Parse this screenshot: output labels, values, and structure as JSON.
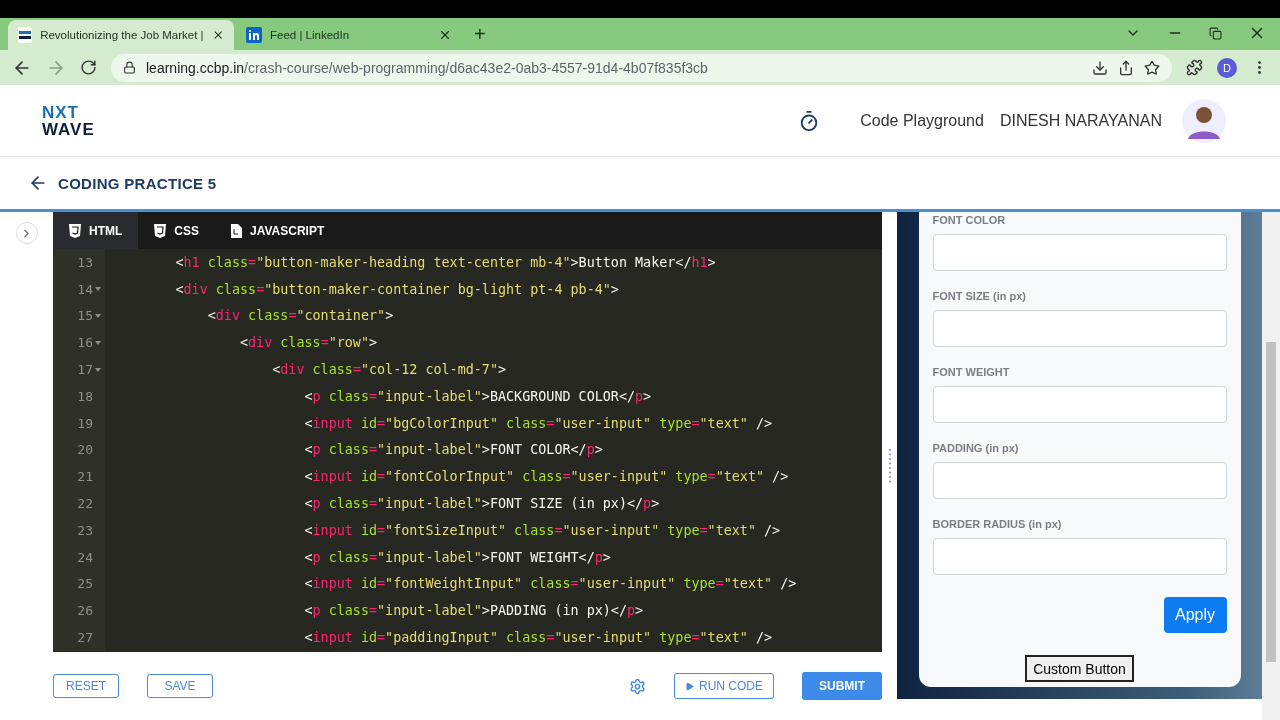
{
  "browser": {
    "tabs": [
      {
        "title": "Revolutionizing the Job Market |",
        "selected": true
      },
      {
        "title": "Feed | LinkedIn",
        "selected": false
      }
    ],
    "new_tab": "+",
    "url_host": "learning.ccbp.in",
    "url_path": "/crash-course/web-programming/d6ac43e2-0ab3-4557-91d4-4b07f835f3cb",
    "profile": "D"
  },
  "header": {
    "logo_top": "NXT",
    "logo_bottom": "WAVE",
    "playground": "Code Playground",
    "user": "DINESH NARAYANAN"
  },
  "page_title": "CODING PRACTICE 5",
  "editor": {
    "tabs": [
      {
        "label": "HTML",
        "selected": true
      },
      {
        "label": "CSS",
        "selected": false
      },
      {
        "label": "JAVASCRIPT",
        "selected": false
      }
    ],
    "lines": [
      {
        "number": "13",
        "text": "        <h1 class=\"button-maker-heading text-center mb-4\">Button Maker</h1>",
        "foldable": false
      },
      {
        "number": "14",
        "text": "        <div class=\"button-maker-container bg-light pt-4 pb-4\">",
        "foldable": true
      },
      {
        "number": "15",
        "text": "            <div class=\"container\">",
        "foldable": true
      },
      {
        "number": "16",
        "text": "                <div class=\"row\">",
        "foldable": true
      },
      {
        "number": "17",
        "text": "                    <div class=\"col-12 col-md-7\">",
        "foldable": true
      },
      {
        "number": "18",
        "text": "                        <p class=\"input-label\">BACKGROUND COLOR</p>",
        "foldable": false
      },
      {
        "number": "19",
        "text": "                        <input id=\"bgColorInput\" class=\"user-input\" type=\"text\" />",
        "foldable": false
      },
      {
        "number": "20",
        "text": "                        <p class=\"input-label\">FONT COLOR</p>",
        "foldable": false
      },
      {
        "number": "21",
        "text": "                        <input id=\"fontColorInput\" class=\"user-input\" type=\"text\" />",
        "foldable": false
      },
      {
        "number": "22",
        "text": "                        <p class=\"input-label\">FONT SIZE (in px)</p>",
        "foldable": false
      },
      {
        "number": "23",
        "text": "                        <input id=\"fontSizeInput\" class=\"user-input\" type=\"text\" />",
        "foldable": false
      },
      {
        "number": "24",
        "text": "                        <p class=\"input-label\">FONT WEIGHT</p>",
        "foldable": false
      },
      {
        "number": "25",
        "text": "                        <input id=\"fontWeightInput\" class=\"user-input\" type=\"text\" />",
        "foldable": false
      },
      {
        "number": "26",
        "text": "                        <p class=\"input-label\">PADDING (in px)</p>",
        "foldable": false
      },
      {
        "number": "27",
        "text": "                        <input id=\"paddingInput\" class=\"user-input\" type=\"text\" />",
        "foldable": false
      }
    ]
  },
  "actions": {
    "reset": "RESET",
    "save": "SAVE",
    "run": "RUN CODE",
    "submit": "SUBMIT"
  },
  "preview": {
    "fields": [
      {
        "label": "FONT COLOR"
      },
      {
        "label": "FONT SIZE (in px)"
      },
      {
        "label": "FONT WEIGHT"
      },
      {
        "label": "PADDING (in px)"
      },
      {
        "label": "BORDER RADIUS (in px)"
      }
    ],
    "apply": "Apply",
    "custom_button": "Custom Button"
  }
}
